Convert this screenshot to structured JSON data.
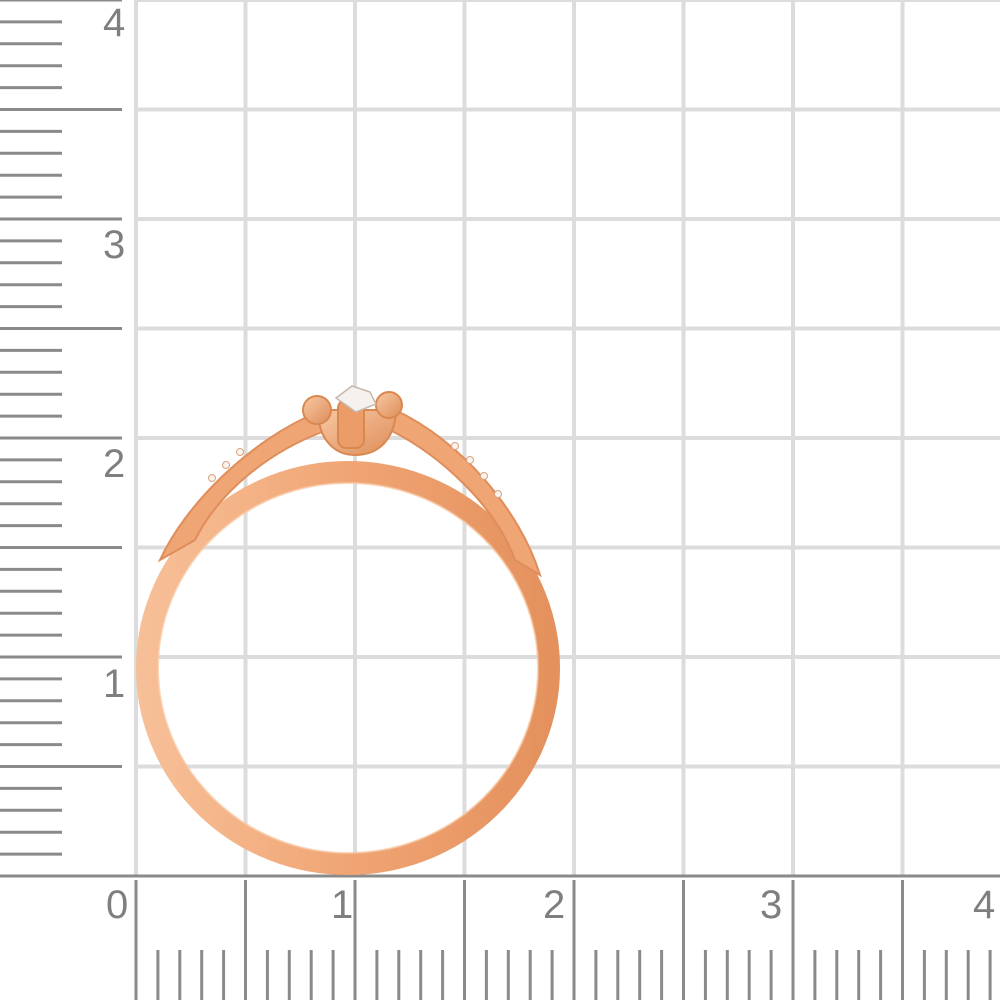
{
  "colors": {
    "background": "#ffffff",
    "grid": "#dcdcdc",
    "ruler": "#8a8a8a",
    "label": "#7f7f7f",
    "gold_light": "#f6b88d",
    "gold_mid": "#f0a574",
    "gold_dark": "#dc8a57",
    "stone": "#f4f1ee"
  },
  "scale": {
    "unit": "cm",
    "x_labels": [
      "0",
      "1",
      "2",
      "3",
      "4"
    ],
    "y_labels": [
      "1",
      "2",
      "3",
      "4"
    ]
  },
  "subject": {
    "object": "ring",
    "icon": "ring-icon",
    "metal": "rose gold",
    "center_stone": "single round white stone",
    "side_stones": "small stones along both shoulders"
  }
}
